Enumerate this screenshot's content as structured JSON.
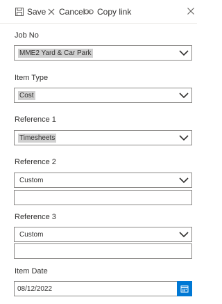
{
  "toolbar": {
    "save_label": "Save",
    "cancel_label": "Cancel",
    "copy_link_label": "Copy link"
  },
  "fields": {
    "job_no": {
      "label": "Job No",
      "value": "MME2 Yard & Car Park"
    },
    "item_type": {
      "label": "Item Type",
      "value": "Cost"
    },
    "reference1": {
      "label": "Reference 1",
      "value": "Timesheets"
    },
    "reference2": {
      "label": "Reference 2",
      "value": "Custom",
      "text": ""
    },
    "reference3": {
      "label": "Reference 3",
      "value": "Custom",
      "text": ""
    },
    "item_date": {
      "label": "Item Date",
      "value": "08/12/2022"
    }
  },
  "colors": {
    "accent": "#0078d4",
    "border": "#8a8886",
    "selection_highlight": "#d0d0d0"
  },
  "icons": [
    "save-icon",
    "cancel-icon",
    "link-icon",
    "close-icon",
    "chevron-down-icon",
    "calendar-icon"
  ]
}
